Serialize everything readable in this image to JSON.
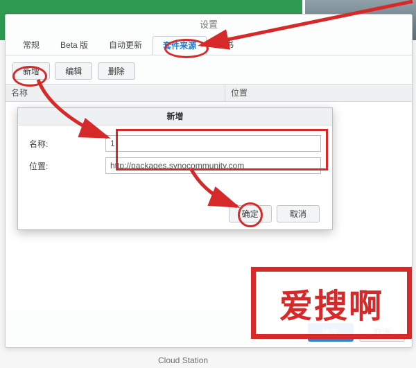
{
  "window": {
    "title": "设置",
    "tabs": [
      "常规",
      "Beta 版",
      "自动更新",
      "套件来源",
      "证书"
    ],
    "active_tab_index": 3,
    "actions": {
      "add": "新增",
      "edit": "编辑",
      "remove": "删除"
    },
    "columns": {
      "name": "名称",
      "location": "位置"
    },
    "footer": {
      "ok": "确定",
      "cancel": "取消"
    }
  },
  "dialog": {
    "title": "新增",
    "fields": {
      "name_label": "名称:",
      "name_value": "1",
      "location_label": "位置:",
      "location_value": "http://packages.synocommunity.com",
      "location_placeholder": ""
    },
    "buttons": {
      "ok": "确定",
      "cancel": "取消"
    }
  },
  "outside": {
    "cloud_station": "Cloud Station"
  },
  "watermark": "爱搜啊"
}
